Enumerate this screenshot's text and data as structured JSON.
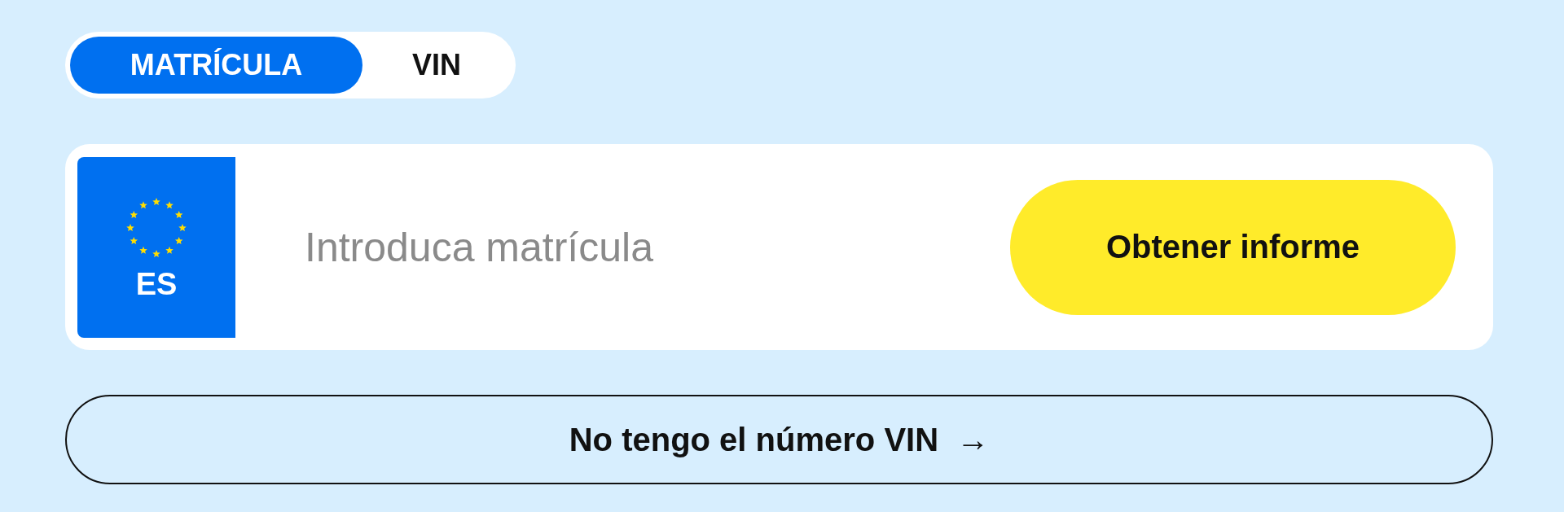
{
  "tabs": [
    {
      "label": "MATRÍCULA",
      "selected": true
    },
    {
      "label": "VIN",
      "selected": false
    }
  ],
  "plate": {
    "country": "ES"
  },
  "search": {
    "placeholder": "Introduca matrícula"
  },
  "submit_button": "Obtener informe",
  "alt_link": {
    "label": "No tengo el número VIN",
    "arrow": "→"
  }
}
